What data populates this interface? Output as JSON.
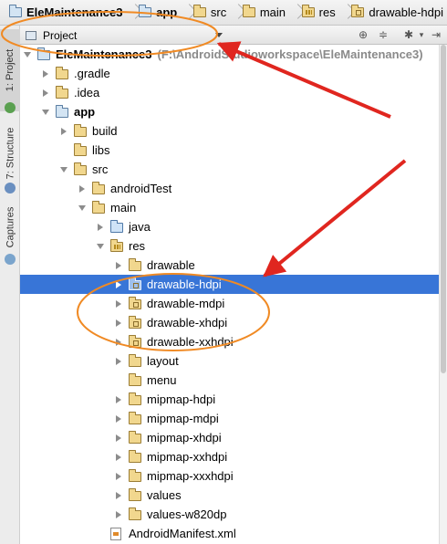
{
  "breadcrumbs": [
    "EleMaintenance3",
    "app",
    "src",
    "main",
    "res",
    "drawable-hdpi"
  ],
  "tool_windows": {
    "project_tab": "1: Project",
    "structure_tab": "7: Structure",
    "captures_tab": "Captures"
  },
  "panel": {
    "view_selector": "Project"
  },
  "tree": [
    {
      "label": "EleMaintenance3",
      "suffix": "(F:\\AndroidStudioworkspace\\EleMaintenance3)",
      "level": 0,
      "expanded": true,
      "bold": true,
      "icon": "module-folder-icon"
    },
    {
      "label": ".gradle",
      "level": 1,
      "expanded": false,
      "icon": "folder-icon"
    },
    {
      "label": ".idea",
      "level": 1,
      "expanded": false,
      "icon": "folder-icon"
    },
    {
      "label": "app",
      "level": 1,
      "expanded": true,
      "bold": true,
      "icon": "module-folder-icon"
    },
    {
      "label": "build",
      "level": 2,
      "expanded": false,
      "icon": "folder-icon"
    },
    {
      "label": "libs",
      "level": 2,
      "leaf": true,
      "icon": "folder-icon"
    },
    {
      "label": "src",
      "level": 2,
      "expanded": true,
      "icon": "folder-icon"
    },
    {
      "label": "androidTest",
      "level": 3,
      "expanded": false,
      "icon": "folder-icon"
    },
    {
      "label": "main",
      "level": 3,
      "expanded": true,
      "icon": "folder-icon"
    },
    {
      "label": "java",
      "level": 4,
      "expanded": false,
      "icon": "source-folder-icon"
    },
    {
      "label": "res",
      "level": 4,
      "expanded": true,
      "icon": "resource-folder-icon"
    },
    {
      "label": "drawable",
      "level": 5,
      "expanded": false,
      "icon": "folder-icon"
    },
    {
      "label": "drawable-hdpi",
      "level": 5,
      "expanded": false,
      "selected": true,
      "icon": "package-folder-icon"
    },
    {
      "label": "drawable-mdpi",
      "level": 5,
      "expanded": false,
      "icon": "package-folder-icon"
    },
    {
      "label": "drawable-xhdpi",
      "level": 5,
      "expanded": false,
      "icon": "package-folder-icon"
    },
    {
      "label": "drawable-xxhdpi",
      "level": 5,
      "expanded": false,
      "icon": "package-folder-icon"
    },
    {
      "label": "layout",
      "level": 5,
      "expanded": false,
      "icon": "folder-icon"
    },
    {
      "label": "menu",
      "level": 5,
      "leaf": true,
      "icon": "folder-icon"
    },
    {
      "label": "mipmap-hdpi",
      "level": 5,
      "expanded": false,
      "icon": "folder-icon"
    },
    {
      "label": "mipmap-mdpi",
      "level": 5,
      "expanded": false,
      "icon": "folder-icon"
    },
    {
      "label": "mipmap-xhdpi",
      "level": 5,
      "expanded": false,
      "icon": "folder-icon"
    },
    {
      "label": "mipmap-xxhdpi",
      "level": 5,
      "expanded": false,
      "icon": "folder-icon"
    },
    {
      "label": "mipmap-xxxhdpi",
      "level": 5,
      "expanded": false,
      "icon": "folder-icon"
    },
    {
      "label": "values",
      "level": 5,
      "expanded": false,
      "icon": "folder-icon"
    },
    {
      "label": "values-w820dp",
      "level": 5,
      "expanded": false,
      "icon": "folder-icon"
    },
    {
      "label": "AndroidManifest.xml",
      "level": 4,
      "leaf": true,
      "icon": "xml-file-icon"
    }
  ],
  "colors": {
    "selection": "#3875d7",
    "annotation_arrow": "#e0261f",
    "annotation_ellipse": "#f08a24"
  }
}
